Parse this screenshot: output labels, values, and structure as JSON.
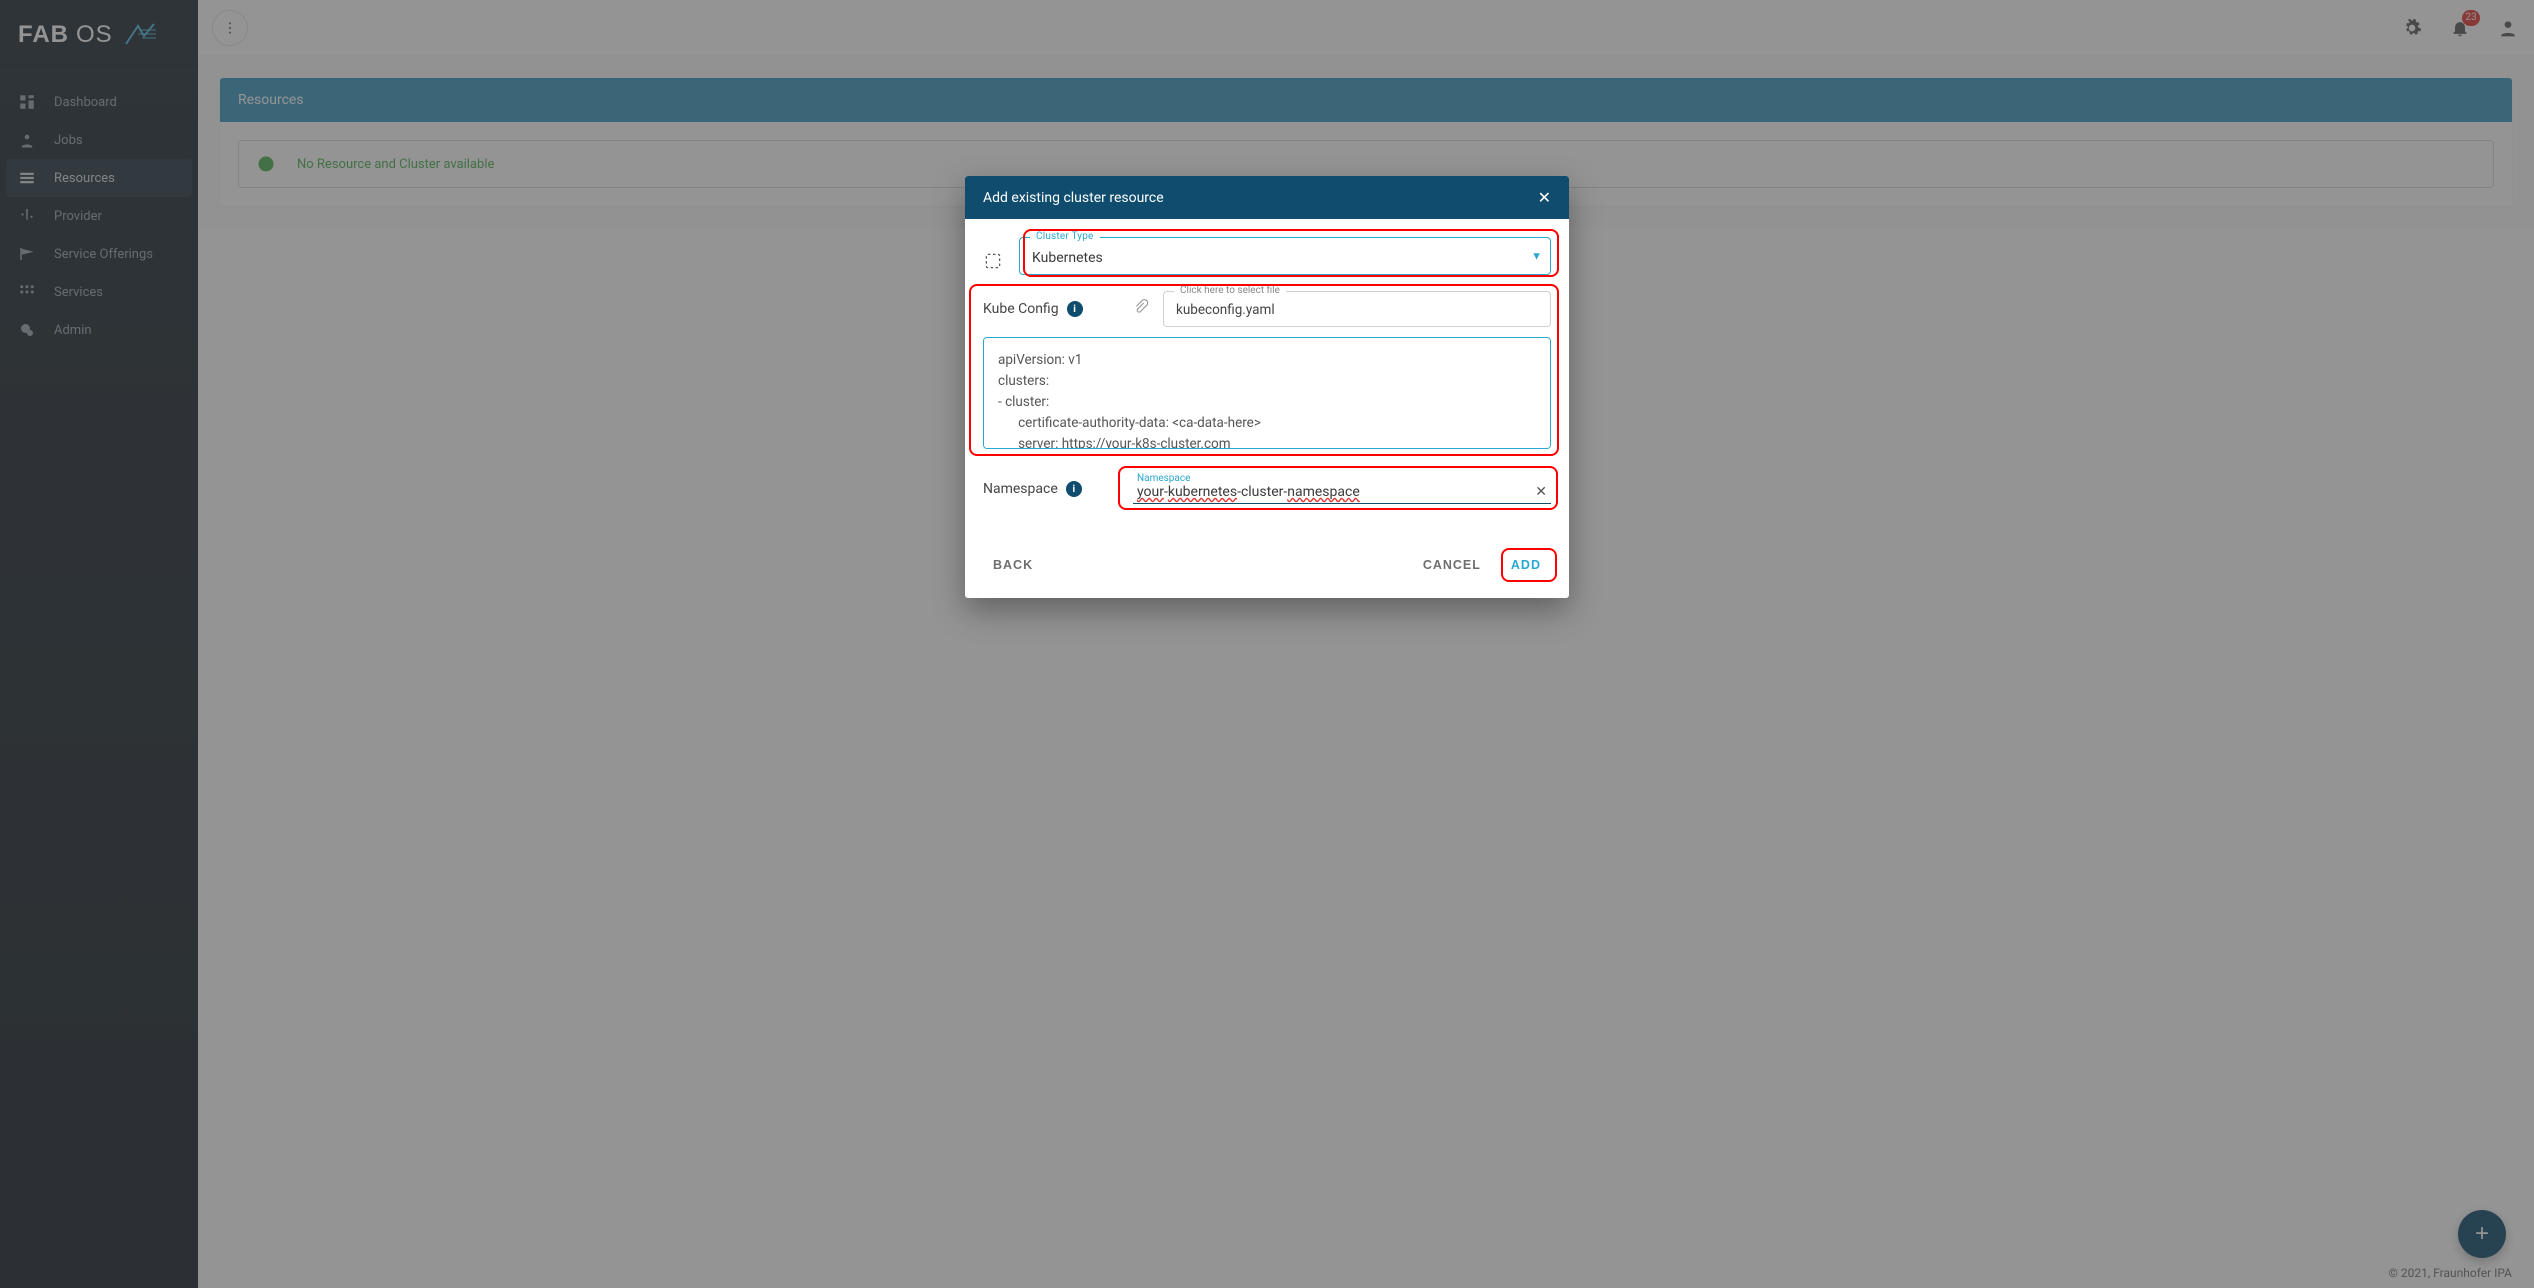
{
  "sidebar": {
    "logo_line1": "FAB",
    "logo_line2": "OS",
    "items": [
      {
        "label": "Dashboard"
      },
      {
        "label": "Jobs"
      },
      {
        "label": "Resources"
      },
      {
        "label": "Provider"
      },
      {
        "label": "Service Offerings"
      },
      {
        "label": "Services"
      },
      {
        "label": "Admin"
      }
    ]
  },
  "topbar": {
    "notifications": "23"
  },
  "card": {
    "title": "Resources",
    "alert": "No Resource and Cluster available"
  },
  "dialog": {
    "title": "Add existing cluster resource",
    "cluster_type_label": "Cluster Type",
    "cluster_type_value": "Kubernetes",
    "kube_config_label": "Kube Config",
    "file_label": "Click here to select file",
    "file_value": "kubeconfig.yaml",
    "kubeconfig_content": "apiVersion: v1\nclusters:\n- cluster:\n      certificate-authority-data: <ca-data-here>\n      server: https://your-k8s-cluster.com",
    "namespace_label": "Namespace",
    "namespace_field_label": "Namespace",
    "namespace_value": "your-kubernetes-cluster-namespace",
    "back": "BACK",
    "cancel": "CANCEL",
    "add": "ADD"
  },
  "footer": "© 2021, Fraunhofer IPA"
}
